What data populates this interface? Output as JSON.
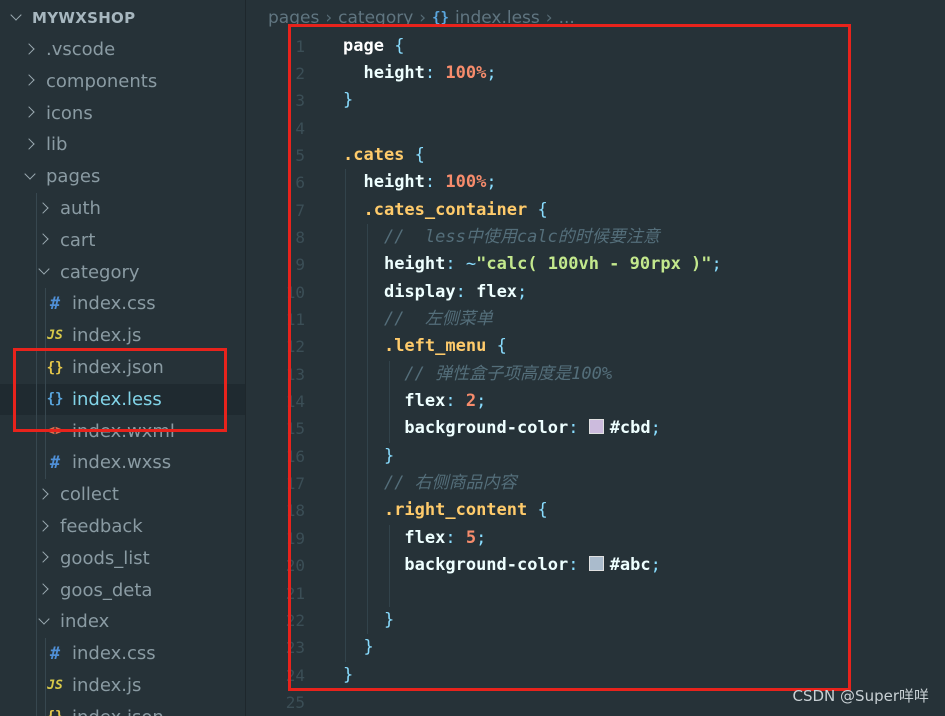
{
  "sidebar": {
    "root": "MYWXSHOP",
    "items": [
      {
        "label": ".vscode",
        "kind": "folder",
        "open": false,
        "depth": 1
      },
      {
        "label": "components",
        "kind": "folder",
        "open": false,
        "depth": 1
      },
      {
        "label": "icons",
        "kind": "folder",
        "open": false,
        "depth": 1
      },
      {
        "label": "lib",
        "kind": "folder",
        "open": false,
        "depth": 1
      },
      {
        "label": "pages",
        "kind": "folder",
        "open": true,
        "depth": 1
      },
      {
        "label": "auth",
        "kind": "folder",
        "open": false,
        "depth": 2
      },
      {
        "label": "cart",
        "kind": "folder",
        "open": false,
        "depth": 2
      },
      {
        "label": "category",
        "kind": "folder",
        "open": true,
        "depth": 2
      },
      {
        "label": "index.css",
        "kind": "css",
        "icon_text": "#",
        "depth": 3
      },
      {
        "label": "index.js",
        "kind": "js",
        "icon_text": "JS",
        "depth": 3
      },
      {
        "label": "index.json",
        "kind": "json",
        "icon_text": "{}",
        "depth": 3
      },
      {
        "label": "index.less",
        "kind": "less",
        "icon_text": "{}",
        "depth": 3,
        "selected": true
      },
      {
        "label": "index.wxml",
        "kind": "wxml",
        "icon_text": "<>",
        "depth": 3
      },
      {
        "label": "index.wxss",
        "kind": "css",
        "icon_text": "#",
        "depth": 3
      },
      {
        "label": "collect",
        "kind": "folder",
        "open": false,
        "depth": 2
      },
      {
        "label": "feedback",
        "kind": "folder",
        "open": false,
        "depth": 2
      },
      {
        "label": "goods_list",
        "kind": "folder",
        "open": false,
        "depth": 2
      },
      {
        "label": "goos_deta",
        "kind": "folder",
        "open": false,
        "depth": 2
      },
      {
        "label": "index",
        "kind": "folder",
        "open": true,
        "depth": 2
      },
      {
        "label": "index.css",
        "kind": "css",
        "icon_text": "#",
        "depth": 3
      },
      {
        "label": "index.js",
        "kind": "js",
        "icon_text": "JS",
        "depth": 3
      },
      {
        "label": "index.json",
        "kind": "json",
        "icon_text": "{}",
        "depth": 3
      }
    ]
  },
  "breadcrumb": {
    "parts": [
      "pages",
      "category"
    ],
    "file_icon": "{}",
    "file": "index.less",
    "trailing": "..."
  },
  "editor": {
    "lines": [
      {
        "n": "1",
        "tokens": [
          [
            "sel",
            "page"
          ],
          [
            "plain",
            " "
          ],
          [
            "brace",
            "{"
          ]
        ]
      },
      {
        "n": "2",
        "tokens": [
          [
            "plain",
            "  "
          ],
          [
            "prop",
            "height"
          ],
          [
            "punc",
            ":"
          ],
          [
            "plain",
            " "
          ],
          [
            "num",
            "100%"
          ],
          [
            "punc",
            ";"
          ]
        ]
      },
      {
        "n": "3",
        "tokens": [
          [
            "brace",
            "}"
          ]
        ]
      },
      {
        "n": "4",
        "tokens": []
      },
      {
        "n": "5",
        "tokens": [
          [
            "cls",
            ".cates"
          ],
          [
            "plain",
            " "
          ],
          [
            "brace",
            "{"
          ]
        ]
      },
      {
        "n": "6",
        "tokens": [
          [
            "plain",
            "  "
          ],
          [
            "prop",
            "height"
          ],
          [
            "punc",
            ":"
          ],
          [
            "plain",
            " "
          ],
          [
            "num",
            "100%"
          ],
          [
            "punc",
            ";"
          ]
        ]
      },
      {
        "n": "7",
        "tokens": [
          [
            "plain",
            "  "
          ],
          [
            "cls",
            ".cates_container"
          ],
          [
            "plain",
            " "
          ],
          [
            "brace",
            "{"
          ]
        ]
      },
      {
        "n": "8",
        "tokens": [
          [
            "plain",
            "    "
          ],
          [
            "comment",
            "//  less中使用calc的时候要注意"
          ]
        ]
      },
      {
        "n": "9",
        "tokens": [
          [
            "plain",
            "    "
          ],
          [
            "prop",
            "height"
          ],
          [
            "punc",
            ":"
          ],
          [
            "plain",
            " "
          ],
          [
            "punc",
            "~"
          ],
          [
            "str",
            "\"calc( 100vh - 90rpx )\""
          ],
          [
            "punc",
            ";"
          ]
        ]
      },
      {
        "n": "10",
        "tokens": [
          [
            "plain",
            "    "
          ],
          [
            "prop",
            "display"
          ],
          [
            "punc",
            ":"
          ],
          [
            "plain",
            " flex"
          ],
          [
            "punc",
            ";"
          ]
        ]
      },
      {
        "n": "11",
        "tokens": [
          [
            "plain",
            "    "
          ],
          [
            "comment",
            "//  左侧菜单"
          ]
        ]
      },
      {
        "n": "12",
        "tokens": [
          [
            "plain",
            "    "
          ],
          [
            "cls",
            ".left_menu"
          ],
          [
            "plain",
            " "
          ],
          [
            "brace",
            "{"
          ]
        ]
      },
      {
        "n": "13",
        "tokens": [
          [
            "plain",
            "      "
          ],
          [
            "comment",
            "// 弹性盒子项高度是100%"
          ]
        ]
      },
      {
        "n": "14",
        "tokens": [
          [
            "plain",
            "      "
          ],
          [
            "prop",
            "flex"
          ],
          [
            "punc",
            ":"
          ],
          [
            "plain",
            " "
          ],
          [
            "num",
            "2"
          ],
          [
            "punc",
            ";"
          ]
        ]
      },
      {
        "n": "15",
        "tokens": [
          [
            "plain",
            "      "
          ],
          [
            "prop",
            "background-color"
          ],
          [
            "punc",
            ":"
          ],
          [
            "plain",
            " "
          ],
          [
            "swatch",
            "#cbd"
          ],
          [
            "plain",
            "#cbd"
          ],
          [
            "punc",
            ";"
          ]
        ]
      },
      {
        "n": "16",
        "tokens": [
          [
            "plain",
            "    "
          ],
          [
            "brace",
            "}"
          ]
        ]
      },
      {
        "n": "17",
        "tokens": [
          [
            "plain",
            "    "
          ],
          [
            "comment",
            "// 右侧商品内容"
          ]
        ]
      },
      {
        "n": "18",
        "tokens": [
          [
            "plain",
            "    "
          ],
          [
            "cls",
            ".right_content"
          ],
          [
            "plain",
            " "
          ],
          [
            "brace",
            "{"
          ]
        ]
      },
      {
        "n": "19",
        "tokens": [
          [
            "plain",
            "      "
          ],
          [
            "prop",
            "flex"
          ],
          [
            "punc",
            ":"
          ],
          [
            "plain",
            " "
          ],
          [
            "num",
            "5"
          ],
          [
            "punc",
            ";"
          ]
        ]
      },
      {
        "n": "20",
        "tokens": [
          [
            "plain",
            "      "
          ],
          [
            "prop",
            "background-color"
          ],
          [
            "punc",
            ":"
          ],
          [
            "plain",
            " "
          ],
          [
            "swatch",
            "#abc"
          ],
          [
            "plain",
            "#abc"
          ],
          [
            "punc",
            ";"
          ]
        ]
      },
      {
        "n": "21",
        "tokens": []
      },
      {
        "n": "22",
        "tokens": [
          [
            "plain",
            "    "
          ],
          [
            "brace",
            "}"
          ]
        ]
      },
      {
        "n": "23",
        "tokens": [
          [
            "plain",
            "  "
          ],
          [
            "brace",
            "}"
          ]
        ]
      },
      {
        "n": "24",
        "tokens": [
          [
            "brace",
            "}"
          ]
        ]
      },
      {
        "n": "25",
        "tokens": []
      }
    ]
  },
  "annotations": {
    "highlight_color": "#e8231c"
  },
  "watermark": "CSDN @Super咩咩"
}
